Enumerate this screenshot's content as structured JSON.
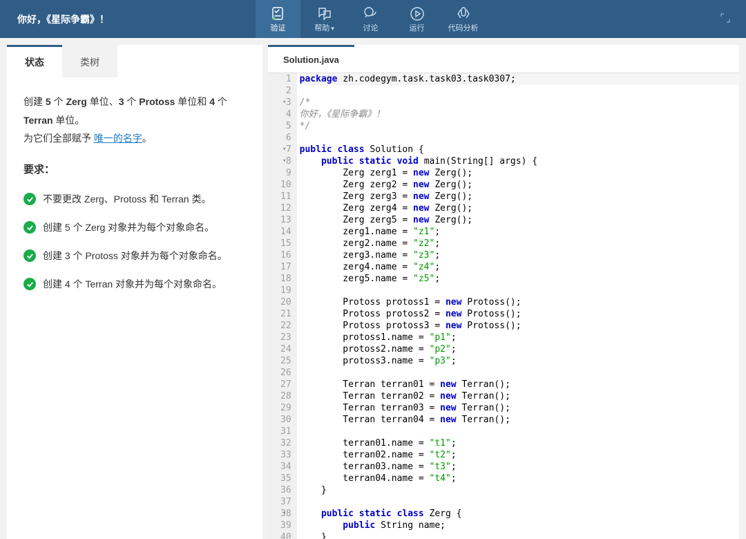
{
  "header": {
    "title": "你好，《星际争霸》！",
    "tools": [
      {
        "label": "验证",
        "active": true
      },
      {
        "label": "帮助",
        "dropdown": true
      },
      {
        "label": "讨论"
      },
      {
        "label": "运行"
      },
      {
        "label": "代码分析"
      }
    ]
  },
  "left": {
    "tabs": [
      {
        "label": "状态",
        "active": true
      },
      {
        "label": "类树",
        "active": false
      }
    ],
    "desc_parts": {
      "t1": "创建 ",
      "b1": "5",
      "t2": " 个 ",
      "b2": "Zerg",
      "t3": " 单位、",
      "b3": "3",
      "t4": " 个 ",
      "b4": "Protoss",
      "t5": " 单位和 ",
      "b5": "4",
      "t6": " 个 ",
      "b6": "Terran",
      "t7": " 单位。",
      "line2a": "为它们全部赋予 ",
      "link": "唯一的名字",
      "line2b": "。"
    },
    "req_title": "要求：",
    "requirements": [
      "不要更改 Zerg、Protoss 和 Terran 类。",
      "创建 5 个 Zerg 对象并为每个对象命名。",
      "创建 3 个 Protoss 对象并为每个对象命名。",
      "创建 4 个 Terran 对象并为每个对象命名。"
    ]
  },
  "right": {
    "filename": "Solution.java",
    "lines": [
      {
        "n": 1,
        "hl": true,
        "fold": false,
        "tokens": [
          [
            "kw",
            "package"
          ],
          [
            "plain",
            " zh.codegym.task.task03.task0307;"
          ]
        ]
      },
      {
        "n": 2,
        "tokens": []
      },
      {
        "n": 3,
        "fold": true,
        "tokens": [
          [
            "cm",
            "/*"
          ]
        ]
      },
      {
        "n": 4,
        "tokens": [
          [
            "cm",
            "你好，《星际争霸》！"
          ]
        ]
      },
      {
        "n": 5,
        "tokens": [
          [
            "cm",
            "*/"
          ]
        ]
      },
      {
        "n": 6,
        "tokens": []
      },
      {
        "n": 7,
        "fold": true,
        "tokens": [
          [
            "kw",
            "public"
          ],
          [
            "plain",
            " "
          ],
          [
            "kw",
            "class"
          ],
          [
            "plain",
            " Solution {"
          ]
        ]
      },
      {
        "n": 8,
        "fold": true,
        "tokens": [
          [
            "plain",
            "    "
          ],
          [
            "kw",
            "public"
          ],
          [
            "plain",
            " "
          ],
          [
            "kw",
            "static"
          ],
          [
            "plain",
            " "
          ],
          [
            "kw",
            "void"
          ],
          [
            "plain",
            " main(String[] args) {"
          ]
        ]
      },
      {
        "n": 9,
        "tokens": [
          [
            "plain",
            "        Zerg zerg1 = "
          ],
          [
            "kw",
            "new"
          ],
          [
            "plain",
            " Zerg();"
          ]
        ]
      },
      {
        "n": 10,
        "tokens": [
          [
            "plain",
            "        Zerg zerg2 = "
          ],
          [
            "kw",
            "new"
          ],
          [
            "plain",
            " Zerg();"
          ]
        ]
      },
      {
        "n": 11,
        "tokens": [
          [
            "plain",
            "        Zerg zerg3 = "
          ],
          [
            "kw",
            "new"
          ],
          [
            "plain",
            " Zerg();"
          ]
        ]
      },
      {
        "n": 12,
        "tokens": [
          [
            "plain",
            "        Zerg zerg4 = "
          ],
          [
            "kw",
            "new"
          ],
          [
            "plain",
            " Zerg();"
          ]
        ]
      },
      {
        "n": 13,
        "tokens": [
          [
            "plain",
            "        Zerg zerg5 = "
          ],
          [
            "kw",
            "new"
          ],
          [
            "plain",
            " Zerg();"
          ]
        ]
      },
      {
        "n": 14,
        "tokens": [
          [
            "plain",
            "        zerg1.name = "
          ],
          [
            "str",
            "\"z1\""
          ],
          [
            "plain",
            ";"
          ]
        ]
      },
      {
        "n": 15,
        "tokens": [
          [
            "plain",
            "        zerg2.name = "
          ],
          [
            "str",
            "\"z2\""
          ],
          [
            "plain",
            ";"
          ]
        ]
      },
      {
        "n": 16,
        "tokens": [
          [
            "plain",
            "        zerg3.name = "
          ],
          [
            "str",
            "\"z3\""
          ],
          [
            "plain",
            ";"
          ]
        ]
      },
      {
        "n": 17,
        "tokens": [
          [
            "plain",
            "        zerg4.name = "
          ],
          [
            "str",
            "\"z4\""
          ],
          [
            "plain",
            ";"
          ]
        ]
      },
      {
        "n": 18,
        "tokens": [
          [
            "plain",
            "        zerg5.name = "
          ],
          [
            "str",
            "\"z5\""
          ],
          [
            "plain",
            ";"
          ]
        ]
      },
      {
        "n": 19,
        "tokens": []
      },
      {
        "n": 20,
        "tokens": [
          [
            "plain",
            "        Protoss protoss1 = "
          ],
          [
            "kw",
            "new"
          ],
          [
            "plain",
            " Protoss();"
          ]
        ]
      },
      {
        "n": 21,
        "tokens": [
          [
            "plain",
            "        Protoss protoss2 = "
          ],
          [
            "kw",
            "new"
          ],
          [
            "plain",
            " Protoss();"
          ]
        ]
      },
      {
        "n": 22,
        "tokens": [
          [
            "plain",
            "        Protoss protoss3 = "
          ],
          [
            "kw",
            "new"
          ],
          [
            "plain",
            " Protoss();"
          ]
        ]
      },
      {
        "n": 23,
        "tokens": [
          [
            "plain",
            "        protoss1.name = "
          ],
          [
            "str",
            "\"p1\""
          ],
          [
            "plain",
            ";"
          ]
        ]
      },
      {
        "n": 24,
        "tokens": [
          [
            "plain",
            "        protoss2.name = "
          ],
          [
            "str",
            "\"p2\""
          ],
          [
            "plain",
            ";"
          ]
        ]
      },
      {
        "n": 25,
        "tokens": [
          [
            "plain",
            "        protoss3.name = "
          ],
          [
            "str",
            "\"p3\""
          ],
          [
            "plain",
            ";"
          ]
        ]
      },
      {
        "n": 26,
        "tokens": []
      },
      {
        "n": 27,
        "tokens": [
          [
            "plain",
            "        Terran terran01 = "
          ],
          [
            "kw",
            "new"
          ],
          [
            "plain",
            " Terran();"
          ]
        ]
      },
      {
        "n": 28,
        "tokens": [
          [
            "plain",
            "        Terran terran02 = "
          ],
          [
            "kw",
            "new"
          ],
          [
            "plain",
            " Terran();"
          ]
        ]
      },
      {
        "n": 29,
        "tokens": [
          [
            "plain",
            "        Terran terran03 = "
          ],
          [
            "kw",
            "new"
          ],
          [
            "plain",
            " Terran();"
          ]
        ]
      },
      {
        "n": 30,
        "tokens": [
          [
            "plain",
            "        Terran terran04 = "
          ],
          [
            "kw",
            "new"
          ],
          [
            "plain",
            " Terran();"
          ]
        ]
      },
      {
        "n": 31,
        "tokens": []
      },
      {
        "n": 32,
        "tokens": [
          [
            "plain",
            "        terran01.name = "
          ],
          [
            "str",
            "\"t1\""
          ],
          [
            "plain",
            ";"
          ]
        ]
      },
      {
        "n": 33,
        "tokens": [
          [
            "plain",
            "        terran02.name = "
          ],
          [
            "str",
            "\"t2\""
          ],
          [
            "plain",
            ";"
          ]
        ]
      },
      {
        "n": 34,
        "tokens": [
          [
            "plain",
            "        terran03.name = "
          ],
          [
            "str",
            "\"t3\""
          ],
          [
            "plain",
            ";"
          ]
        ]
      },
      {
        "n": 35,
        "tokens": [
          [
            "plain",
            "        terran04.name = "
          ],
          [
            "str",
            "\"t4\""
          ],
          [
            "plain",
            ";"
          ]
        ]
      },
      {
        "n": 36,
        "tokens": [
          [
            "plain",
            "    }"
          ]
        ]
      },
      {
        "n": 37,
        "tokens": []
      },
      {
        "n": 38,
        "fold": true,
        "tokens": [
          [
            "plain",
            "    "
          ],
          [
            "kw",
            "public"
          ],
          [
            "plain",
            " "
          ],
          [
            "kw",
            "static"
          ],
          [
            "plain",
            " "
          ],
          [
            "kw",
            "class"
          ],
          [
            "plain",
            " Zerg {"
          ]
        ]
      },
      {
        "n": 39,
        "tokens": [
          [
            "plain",
            "        "
          ],
          [
            "kw",
            "public"
          ],
          [
            "plain",
            " String name;"
          ]
        ]
      },
      {
        "n": 40,
        "tokens": [
          [
            "plain",
            "    }"
          ]
        ]
      }
    ]
  }
}
